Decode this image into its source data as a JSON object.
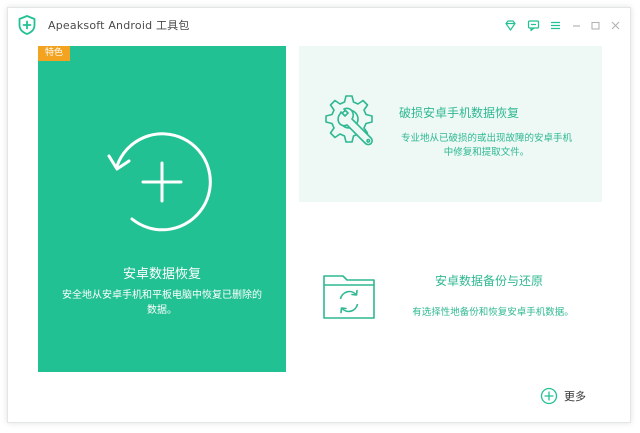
{
  "app": {
    "title": "Apeaksoft Android 工具包"
  },
  "titlebar": {
    "icons": [
      "diamond-icon",
      "feedback-icon",
      "menu-icon",
      "minimize-icon",
      "maximize-icon",
      "close-icon"
    ]
  },
  "tiles": {
    "main": {
      "badge": "特色",
      "title": "安卓数据恢复",
      "description": "安全地从安卓手机和平板电脑中恢复已删除的数据。",
      "icon": "restore-plus-icon"
    },
    "broken": {
      "title": "破损安卓手机数据恢复",
      "description": "专业地从已破损的或出现故障的安卓手机中修复和提取文件。",
      "icon": "gear-wrench-icon"
    },
    "backup": {
      "title": "安卓数据备份与还原",
      "description": "有选择性地备份和恢复安卓手机数据。",
      "icon": "folder-sync-icon"
    }
  },
  "more": {
    "label": "更多",
    "icon": "plus-circle-icon"
  },
  "colors": {
    "accent": "#22c193",
    "accent_text": "#2fb891",
    "badge": "#f4a321",
    "light_tile": "#eef9f6"
  }
}
